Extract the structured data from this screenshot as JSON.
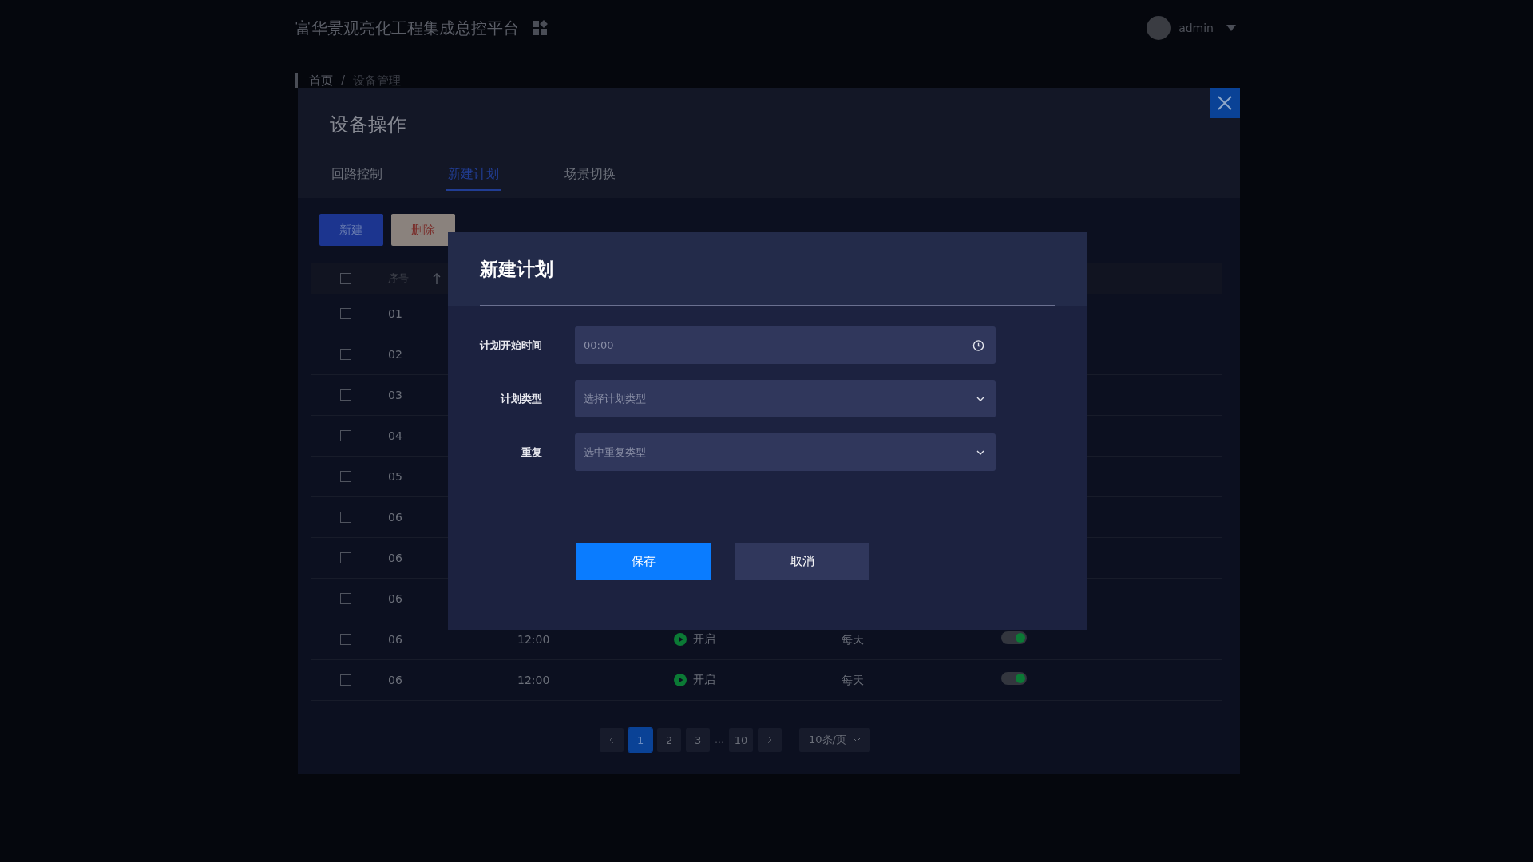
{
  "header": {
    "title": "富华景观亮化工程集成总控平台",
    "user": "admin"
  },
  "breadcrumb": [
    "首页",
    "设备管理"
  ],
  "breadcrumb_separator": "/",
  "panel": {
    "title": "设备操作",
    "tabs": [
      {
        "label": "回路控制",
        "selected": false
      },
      {
        "label": "新建计划",
        "selected": true
      },
      {
        "label": "场景切换",
        "selected": false
      }
    ],
    "actions": [
      {
        "label": "新建",
        "kind": "primary"
      },
      {
        "label": "删除",
        "kind": "danger"
      }
    ],
    "table": {
      "header": {
        "checked": false,
        "column_1": "序号"
      },
      "rows": [
        {
          "no": "01",
          "checked": false
        },
        {
          "no": "02",
          "checked": false
        },
        {
          "no": "03",
          "checked": false
        },
        {
          "no": "04",
          "checked": false
        },
        {
          "no": "05",
          "checked": false
        },
        {
          "no": "06",
          "checked": false
        },
        {
          "no": "06",
          "checked": false
        },
        {
          "no": "06",
          "checked": false
        },
        {
          "no": "06",
          "checked": false,
          "time": "12:00",
          "status": "开启",
          "repeat": "每天",
          "on": true
        },
        {
          "no": "06",
          "checked": false,
          "time": "12:00",
          "status": "开启",
          "repeat": "每天",
          "on": true
        }
      ]
    },
    "pagination": {
      "pages": [
        {
          "label": "1",
          "selected": true
        },
        {
          "label": "2",
          "selected": false
        },
        {
          "label": "3",
          "selected": false
        },
        {
          "label": "…",
          "kind": "ellipsis"
        },
        {
          "label": "10",
          "selected": false
        }
      ],
      "page_size": "10条/页"
    }
  },
  "dialog": {
    "title": "新建计划",
    "fields": [
      {
        "label": "计划开始时间",
        "placeholder": "00:00",
        "kind": "time"
      },
      {
        "label": "计划类型",
        "placeholder": "选择计划类型",
        "kind": "select"
      },
      {
        "label": "重复",
        "placeholder": "选中重复类型",
        "kind": "select"
      }
    ],
    "buttons": [
      {
        "label": "保存",
        "kind": "primary"
      },
      {
        "label": "取消",
        "kind": "secondary"
      }
    ]
  }
}
